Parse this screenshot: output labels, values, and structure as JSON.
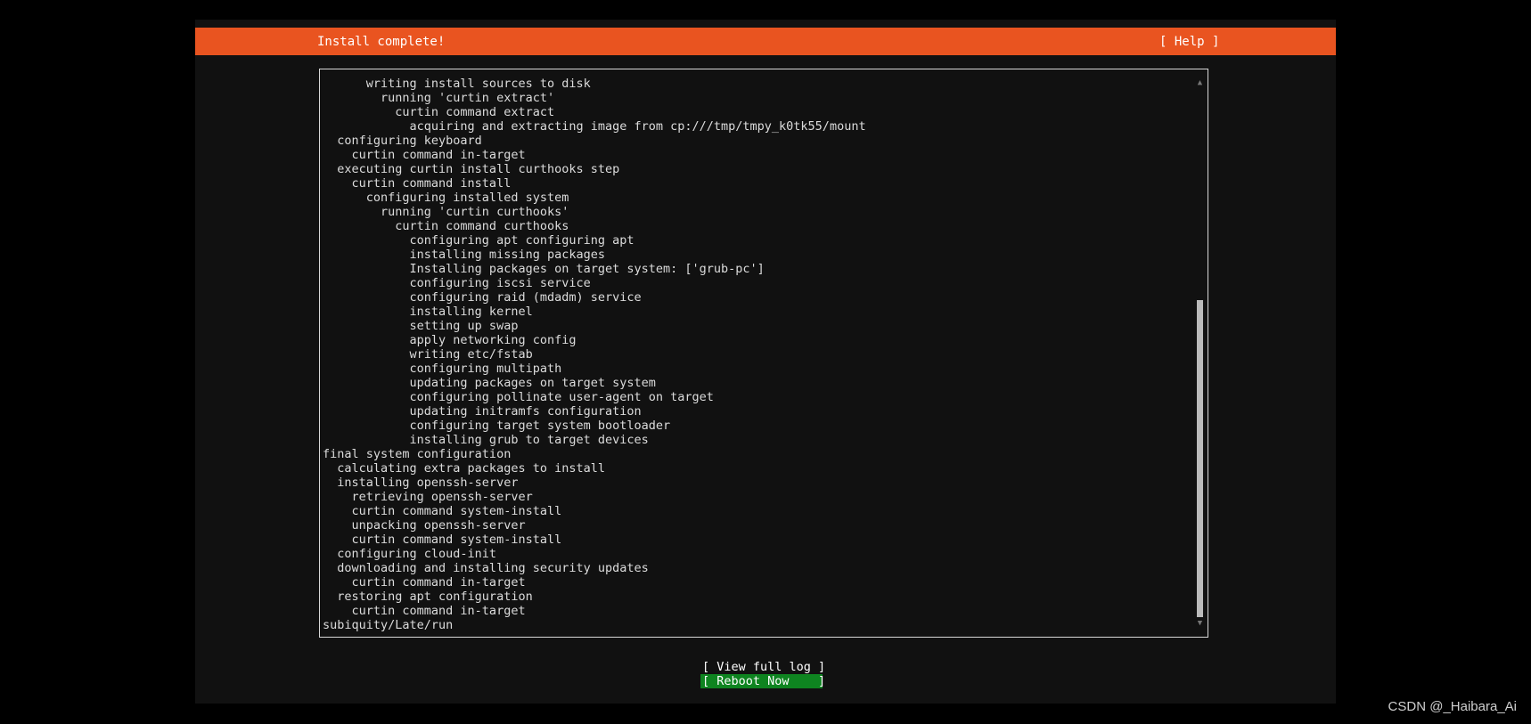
{
  "header": {
    "title": "Install complete!",
    "help": "[ Help ]"
  },
  "log": {
    "lines": [
      "      writing install sources to disk",
      "        running 'curtin extract'",
      "          curtin command extract",
      "            acquiring and extracting image from cp:///tmp/tmpy_k0tk55/mount",
      "  configuring keyboard",
      "    curtin command in-target",
      "  executing curtin install curthooks step",
      "    curtin command install",
      "      configuring installed system",
      "        running 'curtin curthooks'",
      "          curtin command curthooks",
      "            configuring apt configuring apt",
      "            installing missing packages",
      "            Installing packages on target system: ['grub-pc']",
      "            configuring iscsi service",
      "            configuring raid (mdadm) service",
      "            installing kernel",
      "            setting up swap",
      "            apply networking config",
      "            writing etc/fstab",
      "            configuring multipath",
      "            updating packages on target system",
      "            configuring pollinate user-agent on target",
      "            updating initramfs configuration",
      "            configuring target system bootloader",
      "            installing grub to target devices",
      "final system configuration",
      "  calculating extra packages to install",
      "  installing openssh-server",
      "    retrieving openssh-server",
      "    curtin command system-install",
      "    unpacking openssh-server",
      "    curtin command system-install",
      "  configuring cloud-init",
      "  downloading and installing security updates",
      "    curtin command in-target",
      "  restoring apt configuration",
      "    curtin command in-target",
      "subiquity/Late/run"
    ],
    "scroll": {
      "up_icon": "▲",
      "down_icon": "▼",
      "thumb_start_fraction": 0.4,
      "thumb_end_fraction": 1.0
    }
  },
  "actions": {
    "view_log": "[ View full log ]",
    "reboot": "[ Reboot Now    ]"
  },
  "watermark": "CSDN @_Haibara_Ai",
  "colors": {
    "accent": "#e95420",
    "button_focus": "#0e8420",
    "background": "#111111"
  }
}
